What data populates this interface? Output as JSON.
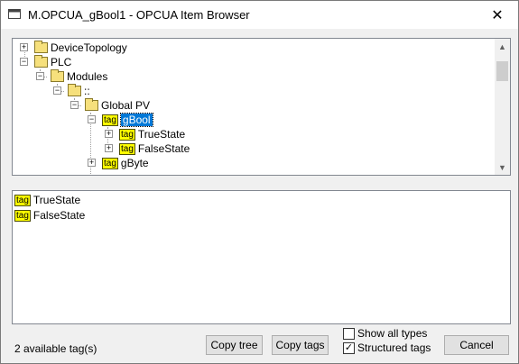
{
  "window": {
    "title": "M.OPCUA_gBool1 - OPCUA Item Browser",
    "close_glyph": "✕"
  },
  "tree": {
    "items": [
      {
        "label": "DeviceTopology",
        "icon": "folder-icon",
        "expander": "+"
      },
      {
        "label": "PLC",
        "icon": "folder-icon",
        "expander": "−"
      },
      {
        "label": "Modules",
        "icon": "folder-icon",
        "expander": "−"
      },
      {
        "label": "::",
        "icon": "folder-icon",
        "expander": "−"
      },
      {
        "label": "Global PV",
        "icon": "folder-icon",
        "expander": "−"
      },
      {
        "label": "gBool",
        "icon": "tag-icon",
        "expander": "−",
        "selected": true
      },
      {
        "label": "TrueState",
        "icon": "tag-icon",
        "expander": "+"
      },
      {
        "label": "FalseState",
        "icon": "tag-icon",
        "expander": "+"
      },
      {
        "label": "gByte",
        "icon": "tag-icon",
        "expander": "+"
      }
    ],
    "tag_icon_text": "tag",
    "scroll_up_glyph": "▲",
    "scroll_down_glyph": "▼"
  },
  "tags_list": {
    "items": [
      {
        "label": "TrueState",
        "icon": "tag-icon"
      },
      {
        "label": "FalseState",
        "icon": "tag-icon"
      }
    ]
  },
  "footer": {
    "status": "2 available tag(s)",
    "copy_tree_label": "Copy tree",
    "copy_tags_label": "Copy tags",
    "show_all_types_label": "Show all types",
    "show_all_types_checked": false,
    "structured_tags_label": "Structured tags",
    "structured_tags_checked": true,
    "check_glyph": "✓",
    "cancel_label": "Cancel"
  },
  "colors": {
    "selection": "#0078d7",
    "tag_background": "#ffff00",
    "folder": "#f6e07c"
  }
}
